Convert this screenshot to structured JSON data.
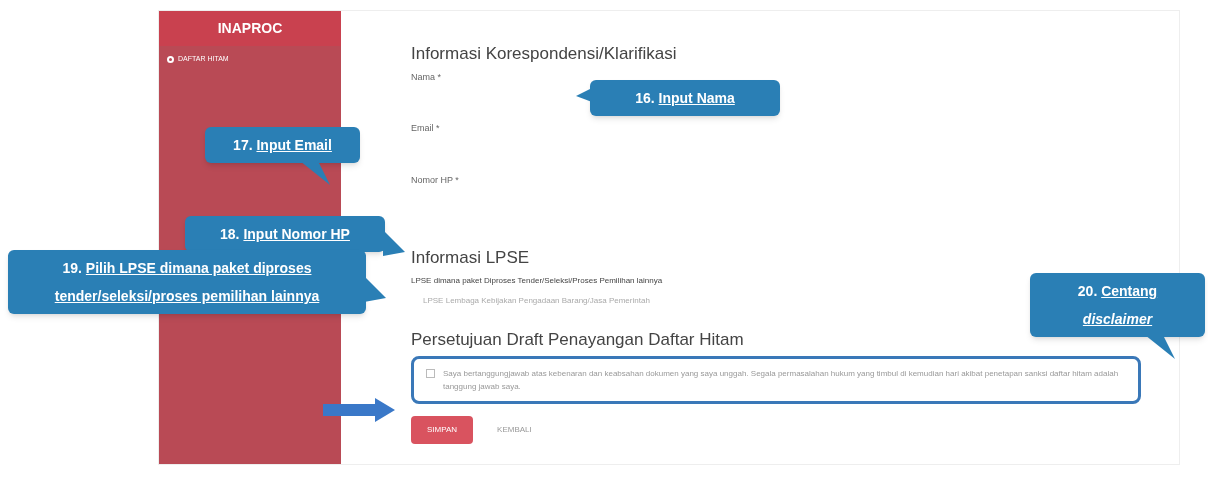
{
  "sidebar": {
    "brand": "INAPROC",
    "items": [
      {
        "label": "DAFTAR HITAM",
        "selected": true
      }
    ]
  },
  "form": {
    "sections": [
      {
        "title": "Informasi Korespondensi/Klarifikasi",
        "fields": [
          {
            "kind": "text",
            "label": "Nama *"
          },
          {
            "kind": "text",
            "label": "Email *"
          },
          {
            "kind": "text",
            "label": "Nomor HP *"
          }
        ]
      },
      {
        "title": "Informasi LPSE",
        "fields": [
          {
            "kind": "select",
            "label": "LPSE dimana paket Diproses Tender/Seleksi/Proses Pemilihan lainnya",
            "value": "LPSE Lembaga Kebijakan Pengadaan Barang/Jasa Pemerintah"
          }
        ]
      },
      {
        "title": "Persetujuan Draft Penayangan Daftar Hitam",
        "fields": [
          {
            "kind": "checkbox",
            "checked": false,
            "label": "Saya bertanggungjawab atas kebenaran dan keabsahan dokumen yang saya unggah. Segala permasalahan hukum yang timbul di kemudian hari akibat penetapan sanksi daftar hitam adalah tanggung jawab saya."
          }
        ]
      }
    ],
    "buttons": [
      {
        "label": "SIMPAN",
        "kind": "primary"
      },
      {
        "label": "KEMBALI",
        "kind": "plain"
      }
    ]
  },
  "callouts": [
    {
      "number": "16.",
      "text": "Input Nama",
      "kind": "left"
    },
    {
      "number": "17.",
      "text": "Input Email",
      "kind": "down"
    },
    {
      "number": "18.",
      "text": "Input Nomor HP",
      "kind": "right"
    },
    {
      "number": "19.",
      "text": "Pilih LPSE dimana paket diproses tender/seleksi/proses pemilihan lainnya",
      "kind": "right"
    },
    {
      "number": "20.",
      "text": "Centang *disclaimer*",
      "kind": "down"
    }
  ]
}
